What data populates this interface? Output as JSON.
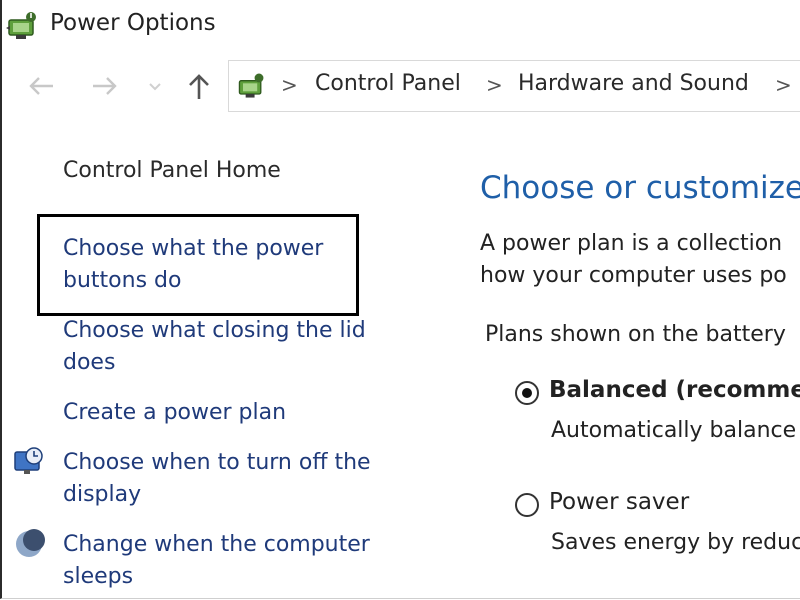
{
  "window": {
    "title": "Power Options",
    "app_icon": "power-options-icon"
  },
  "nav": {
    "back_icon": "arrow-left-icon",
    "forward_icon": "arrow-right-icon",
    "recent_icon": "chevron-down-icon",
    "up_icon": "arrow-up-icon",
    "breadcrumb": [
      "Control Panel",
      "Hardware and Sound"
    ],
    "separator": ">"
  },
  "sidebar": {
    "home": "Control Panel Home",
    "links": [
      {
        "line1": "Choose what the power",
        "line2": "buttons do"
      },
      {
        "line1": "Choose what closing the lid",
        "line2": "does"
      },
      {
        "line1": "Create a power plan"
      },
      {
        "line1": "Choose when to turn off the",
        "line2": "display",
        "icon": "display-clock-icon"
      },
      {
        "line1": "Change when the computer",
        "line2": "sleeps",
        "icon": "moon-sleep-icon"
      }
    ]
  },
  "main": {
    "heading": "Choose or customize",
    "description_line1": "A power plan is a collection",
    "description_line2": "how your computer uses po",
    "plans_label": "Plans shown on the battery",
    "plans": [
      {
        "name": "Balanced (recommen",
        "description": "Automatically balance",
        "selected": true
      },
      {
        "name": "Power saver",
        "description": "Saves energy by reduc",
        "selected": false
      }
    ]
  },
  "colors": {
    "link": "#1f3a7a",
    "heading": "#1f5fa8",
    "focus_border": "#000000"
  }
}
